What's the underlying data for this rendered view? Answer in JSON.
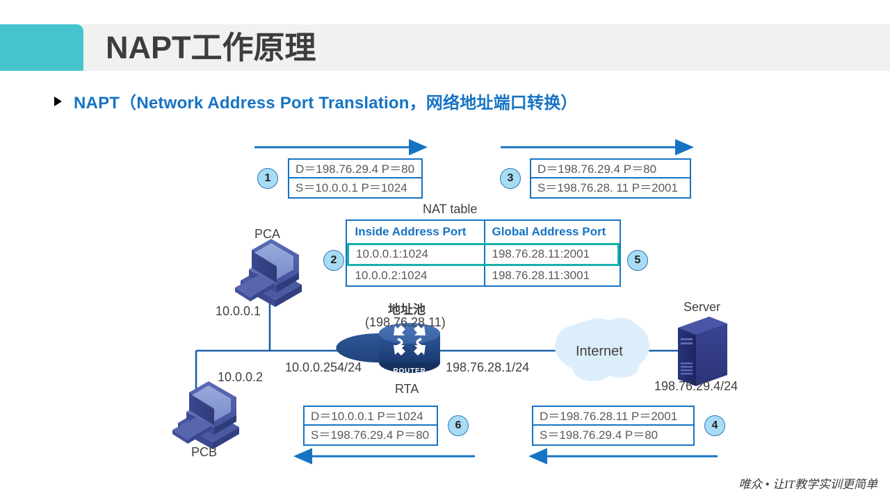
{
  "header": {
    "title": "NAPT工作原理",
    "accent_color": "#45c4ce",
    "bar_color": "#f1f1f1"
  },
  "subtitle": {
    "text": "NAPT（Network Address Port Translation，网络地址端口转换）",
    "color": "#1673c4"
  },
  "diagram": {
    "nat_table": {
      "caption": "NAT table",
      "columns": [
        "Inside Address Port",
        "Global Address Port"
      ],
      "rows": [
        {
          "inside": "10.0.0.1:1024",
          "global": "198.76.28.11:2001",
          "highlighted": true
        },
        {
          "inside": "10.0.0.2:1024",
          "global": "198.76.28.11:3001",
          "highlighted": false
        }
      ],
      "highlight_color": "#14b3ad",
      "border_color": "#1673c4"
    },
    "packets": [
      {
        "id": "packet-1",
        "badge": "1",
        "dest": "D＝198.76.29.4 P＝80",
        "src": "S＝10.0.0.1 P＝1024"
      },
      {
        "id": "packet-3",
        "badge": "3",
        "dest": "D＝198.76.29.4 P＝80",
        "src": "S＝198.76.28. 11 P＝2001"
      },
      {
        "id": "packet-6",
        "badge": "6",
        "dest": "D＝10.0.0.1 P＝1024",
        "src": "S＝198.76.29.4 P＝80"
      },
      {
        "id": "packet-4",
        "badge": "4",
        "dest": "D＝198.76.28.11 P＝2001",
        "src": "S＝198.76.29.4 P＝80"
      }
    ],
    "badges": {
      "nat_left": "2",
      "nat_right": "5"
    },
    "nodes": {
      "pca": {
        "label": "PCA",
        "address": "10.0.0.1"
      },
      "pcb": {
        "label": "PCB",
        "address": "10.0.0.2"
      },
      "router": {
        "label": "RTA",
        "glyph_label": "ROUTER",
        "pool_title": "地址池",
        "pool_address": "(198.76.28.11)",
        "inside_if": "10.0.0.254/24",
        "outside_if": "198.76.28.1/24"
      },
      "cloud": {
        "label": "Internet"
      },
      "server": {
        "label": "Server",
        "address": "198.76.29.4/24"
      }
    }
  },
  "footer": {
    "text": "唯众 • 让IT教学实训更简单"
  }
}
